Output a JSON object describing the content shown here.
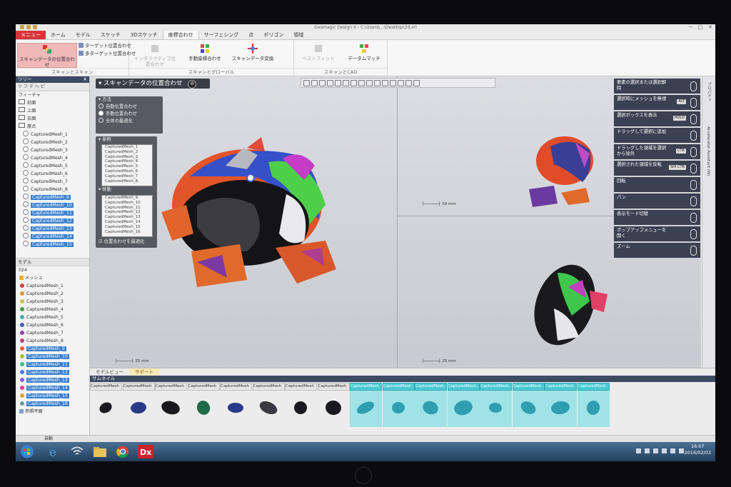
{
  "window": {
    "title": "Geomagic Design X - C:\\Users\\...\\Desktop\\2d.xrl",
    "controls": [
      "─",
      "□",
      "✕"
    ]
  },
  "ribbon_tabs": [
    "メニュー",
    "ホーム",
    "モデル",
    "スケッチ",
    "3Dスケッチ",
    "座標合わせ",
    "サーフェシング",
    "点",
    "ポリゴン",
    "領域"
  ],
  "ribbon": {
    "groups": [
      {
        "label": "スキャンとスキャン"
      },
      {
        "label": "スキャンとグローバル"
      },
      {
        "label": "スキャンとCAD"
      }
    ],
    "buttons": {
      "scan_align": "スキャンデータの位置合わせ",
      "target_align": "ターゲット位置合わせ",
      "multi_target_align": "多ターゲット位置合わせ",
      "interactive_align": "インタラクティブ位置合わせ",
      "manual_coord": "手動座標合わせ",
      "scan_transform": "スキャンデータ変換",
      "best_fit": "ベストフィット",
      "datum_match": "データムマッチ"
    }
  },
  "left_panel": {
    "title": "ツリー",
    "toolbar": "ツ  フ  デ  ヘ  ビ",
    "feature_header": "フィーチャ",
    "feature_items": [
      {
        "label": "前面",
        "sel": false
      },
      {
        "label": "上面",
        "sel": false
      },
      {
        "label": "右面",
        "sel": false
      },
      {
        "label": "原点",
        "sel": false
      },
      {
        "label": "CapturedMesh_1",
        "sel": false
      },
      {
        "label": "CapturedMesh_2",
        "sel": false
      },
      {
        "label": "CapturedMesh_3",
        "sel": false
      },
      {
        "label": "CapturedMesh_4",
        "sel": false
      },
      {
        "label": "CapturedMesh_5",
        "sel": false
      },
      {
        "label": "CapturedMesh_6",
        "sel": false
      },
      {
        "label": "CapturedMesh_7",
        "sel": false
      },
      {
        "label": "CapturedMesh_8",
        "sel": false
      },
      {
        "label": "CapturedMesh_9",
        "sel": true
      },
      {
        "label": "CapturedMesh_10",
        "sel": true
      },
      {
        "label": "CapturedMesh_11",
        "sel": true
      },
      {
        "label": "CapturedMesh_12",
        "sel": true
      },
      {
        "label": "CapturedMesh_13",
        "sel": true
      },
      {
        "label": "CapturedMesh_14",
        "sel": true
      },
      {
        "label": "CapturedMesh_15",
        "sel": true
      }
    ],
    "model_header": "モデル",
    "model_file": "024",
    "mesh_group": "メッシュ",
    "mesh_items": [
      {
        "label": "CapturedMesh_1",
        "color": "#d64040",
        "sel": false
      },
      {
        "label": "CapturedMesh_2",
        "color": "#e09a30",
        "sel": false
      },
      {
        "label": "CapturedMesh_3",
        "color": "#d0c040",
        "sel": false
      },
      {
        "label": "CapturedMesh_4",
        "color": "#40a040",
        "sel": false
      },
      {
        "label": "CapturedMesh_5",
        "color": "#40b0b0",
        "sel": false
      },
      {
        "label": "CapturedMesh_6",
        "color": "#4060c0",
        "sel": false
      },
      {
        "label": "CapturedMesh_7",
        "color": "#9040b0",
        "sel": false
      },
      {
        "label": "CapturedMesh_8",
        "color": "#c04080",
        "sel": false
      },
      {
        "label": "CapturedMesh_9",
        "color": "#e06040",
        "sel": true
      },
      {
        "label": "CapturedMesh_10",
        "color": "#a0c040",
        "sel": true
      },
      {
        "label": "CapturedMesh_11",
        "color": "#40c080",
        "sel": true
      },
      {
        "label": "CapturedMesh_12",
        "color": "#4080e0",
        "sel": true
      },
      {
        "label": "CapturedMesh_13",
        "color": "#8060e0",
        "sel": true
      },
      {
        "label": "CapturedMesh_14",
        "color": "#e040a0",
        "sel": true
      },
      {
        "label": "CapturedMesh_15",
        "color": "#e0a040",
        "sel": true
      },
      {
        "label": "CapturedMesh_16",
        "color": "#60a0a0",
        "sel": true
      }
    ],
    "ref_plane": "参照平面"
  },
  "dialog": {
    "title": "スキャンデータの位置合わせ",
    "method_header": "方法",
    "methods": [
      {
        "label": "自動位置合わせ",
        "on": false
      },
      {
        "label": "手動位置合わせ",
        "on": true
      },
      {
        "label": "全体の最適化",
        "on": false
      }
    ],
    "fixed_header": "参照",
    "fixed_list": [
      "CapturedMesh_1",
      "CapturedMesh_2",
      "CapturedMesh_3",
      "CapturedMesh_4",
      "CapturedMesh_5",
      "CapturedMesh_6",
      "CapturedMesh_7",
      "CapturedMesh_8"
    ],
    "moving_header": "移動",
    "moving_list": [
      "CapturedMesh_9",
      "CapturedMesh_10",
      "CapturedMesh_11",
      "CapturedMesh_12",
      "CapturedMesh_13",
      "CapturedMesh_14",
      "CapturedMesh_15",
      "CapturedMesh_16"
    ],
    "option": "位置合わせを最適化"
  },
  "viewport": {
    "scale_left": "25 mm",
    "scale_right_top": "50 mm",
    "scale_right_bottom": "25 mm"
  },
  "tips": [
    {
      "text": "要素の選択または選択解除",
      "key": ""
    },
    {
      "text": "選択時にメッシュを無視",
      "key": "ALT"
    },
    {
      "text": "選択ボックスを表示",
      "key": "HOLD"
    },
    {
      "text": "ドラッグして選択に追加",
      "key": ""
    },
    {
      "text": "ドラッグした領域を選択から除外",
      "key": "CTR"
    },
    {
      "text": "選択された領域を反転",
      "key": "SHI CTR"
    },
    {
      "text": "回転",
      "key": ""
    },
    {
      "text": "パン",
      "key": ""
    },
    {
      "text": "表示モード切替",
      "key": ""
    },
    {
      "text": "ポップアップメニューを開く",
      "key": ""
    },
    {
      "text": "ズーム",
      "key": ""
    }
  ],
  "right_strip": [
    "プロパティ",
    "Accelerator Assistant (W)"
  ],
  "bottom_tabs": [
    {
      "label": "モデルビュー",
      "active": false
    },
    {
      "label": "サポート",
      "active": true
    }
  ],
  "thumbnails": {
    "title": "サムネイル",
    "items": [
      {
        "label": "CapturedMesh",
        "sel": false
      },
      {
        "label": "CapturedMesh",
        "sel": false
      },
      {
        "label": "CapturedMesh",
        "sel": false
      },
      {
        "label": "CapturedMesh",
        "sel": false
      },
      {
        "label": "CapturedMesh",
        "sel": false
      },
      {
        "label": "CapturedMesh",
        "sel": false
      },
      {
        "label": "CapturedMesh",
        "sel": false
      },
      {
        "label": "CapturedMesh",
        "sel": false
      },
      {
        "label": "CapturedMesh",
        "sel": true
      },
      {
        "label": "CapturedMesh",
        "sel": true
      },
      {
        "label": "CapturedMesh",
        "sel": true
      },
      {
        "label": "CapturedMesh",
        "sel": true
      },
      {
        "label": "CapturedMesh",
        "sel": true
      },
      {
        "label": "CapturedMesh",
        "sel": true
      },
      {
        "label": "CapturedMesh",
        "sel": true
      },
      {
        "label": "CapturedMesh",
        "sel": true
      }
    ]
  },
  "statusbar": {
    "label": "自動"
  },
  "clock": {
    "time": "16:07",
    "date": "2016/02/03"
  },
  "colors": {
    "menu_tab": "#d9343a",
    "selection": "#3a80d0",
    "thumb_selected": "#9fe3e7",
    "panel_header": "#3d4a63"
  }
}
